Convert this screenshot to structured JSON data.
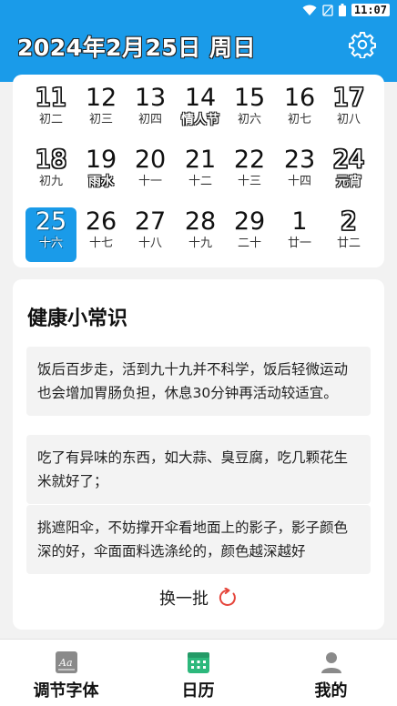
{
  "status_bar": {
    "time": "11:07"
  },
  "header": {
    "title": "2024年2月25日 周日"
  },
  "calendar": {
    "rows": [
      [
        {
          "day": "11",
          "lunar": "初二",
          "outlined": true,
          "festival": false,
          "selected": false
        },
        {
          "day": "12",
          "lunar": "初三",
          "outlined": false,
          "festival": false,
          "selected": false
        },
        {
          "day": "13",
          "lunar": "初四",
          "outlined": false,
          "festival": false,
          "selected": false
        },
        {
          "day": "14",
          "lunar": "情人节",
          "outlined": false,
          "festival": true,
          "selected": false
        },
        {
          "day": "15",
          "lunar": "初六",
          "outlined": false,
          "festival": false,
          "selected": false
        },
        {
          "day": "16",
          "lunar": "初七",
          "outlined": false,
          "festival": false,
          "selected": false
        },
        {
          "day": "17",
          "lunar": "初八",
          "outlined": true,
          "festival": false,
          "selected": false
        }
      ],
      [
        {
          "day": "18",
          "lunar": "初九",
          "outlined": true,
          "festival": false,
          "selected": false
        },
        {
          "day": "19",
          "lunar": "雨水",
          "outlined": false,
          "festival": true,
          "selected": false
        },
        {
          "day": "20",
          "lunar": "十一",
          "outlined": false,
          "festival": false,
          "selected": false
        },
        {
          "day": "21",
          "lunar": "十二",
          "outlined": false,
          "festival": false,
          "selected": false
        },
        {
          "day": "22",
          "lunar": "十三",
          "outlined": false,
          "festival": false,
          "selected": false
        },
        {
          "day": "23",
          "lunar": "十四",
          "outlined": false,
          "festival": false,
          "selected": false
        },
        {
          "day": "24",
          "lunar": "元宵",
          "outlined": true,
          "festival": true,
          "selected": false
        }
      ],
      [
        {
          "day": "25",
          "lunar": "十六",
          "outlined": true,
          "festival": false,
          "selected": true
        },
        {
          "day": "26",
          "lunar": "十七",
          "outlined": false,
          "festival": false,
          "selected": false
        },
        {
          "day": "27",
          "lunar": "十八",
          "outlined": false,
          "festival": false,
          "selected": false
        },
        {
          "day": "28",
          "lunar": "十九",
          "outlined": false,
          "festival": false,
          "selected": false
        },
        {
          "day": "29",
          "lunar": "二十",
          "outlined": false,
          "festival": false,
          "selected": false
        },
        {
          "day": "1",
          "lunar": "廿一",
          "outlined": false,
          "festival": false,
          "selected": false
        },
        {
          "day": "2",
          "lunar": "廿二",
          "outlined": true,
          "festival": false,
          "selected": false
        }
      ]
    ]
  },
  "health": {
    "title": "健康小常识",
    "tips": [
      "饭后百步走，活到九十九并不科学，饭后轻微运动也会增加胃肠负担，休息30分钟再活动较适宜。",
      "吃了有异味的东西，如大蒜、臭豆腐，吃几颗花生米就好了；",
      "挑遮阳伞，不妨撑开伞看地面上的影子，影子颜色深的好，伞面面料选涤纶的，颜色越深越好"
    ],
    "refresh_label": "换一批"
  },
  "bottom_nav": {
    "items": [
      {
        "label": "调节字体",
        "icon": "font-size-icon"
      },
      {
        "label": "日历",
        "icon": "calendar-icon"
      },
      {
        "label": "我的",
        "icon": "user-icon"
      }
    ]
  },
  "colors": {
    "primary": "#1a9be9",
    "calendar_icon": "#2db87c",
    "refresh_icon": "#e5453b"
  }
}
